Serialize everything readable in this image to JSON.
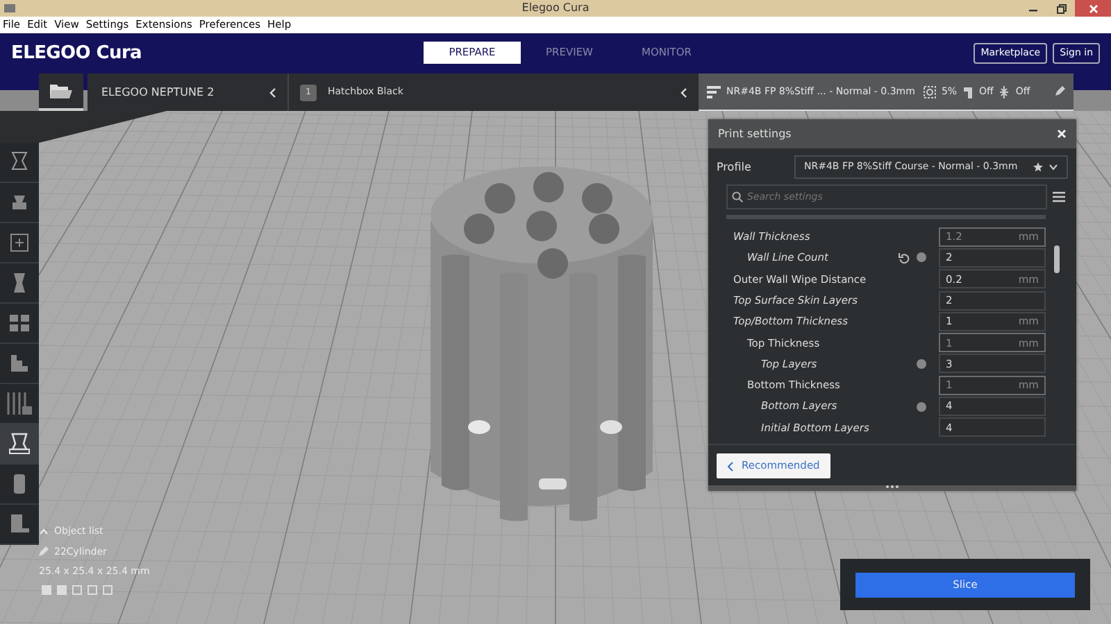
{
  "window": {
    "title": "Elegoo Cura"
  },
  "menu": [
    "File",
    "Edit",
    "View",
    "Settings",
    "Extensions",
    "Preferences",
    "Help"
  ],
  "header": {
    "logo": "ELEGOO Cura",
    "stages": [
      {
        "label": "PREPARE",
        "selected": true
      },
      {
        "label": "PREVIEW",
        "selected": false
      },
      {
        "label": "MONITOR",
        "selected": false
      }
    ],
    "buttons": [
      "Marketplace",
      "Sign in"
    ]
  },
  "toolbar": {
    "printer": "ELEGOO NEPTUNE 2",
    "extruder": "1",
    "material": "Hatchbox Black",
    "profile": "NR#4B FP 8%Stiff ... - Normal - 0.3mm",
    "infill": "5%",
    "support": "Off",
    "adhesion": "Off"
  },
  "tools": [
    {
      "selected": false
    },
    {
      "selected": false
    },
    {
      "selected": false
    },
    {
      "selected": false
    },
    {
      "selected": false
    },
    {
      "selected": false
    },
    {
      "selected": false
    },
    {
      "selected": true
    },
    {
      "selected": false
    },
    {
      "selected": false
    }
  ],
  "object_list": {
    "toggle": "Object list",
    "object": "22Cylinder",
    "dimensions": "25.4 x 25.4 x 25.4 mm"
  },
  "print_settings": {
    "title": "Print settings",
    "profile_label": "Profile",
    "profile": "NR#4B FP 8%Stiff Course - Normal - 0.3mm",
    "search": {
      "placeholder": "Search settings"
    },
    "settings": [
      {
        "label": "Wall Thickness",
        "changed": true,
        "reset": false,
        "info": false,
        "value": "1.2",
        "unit": "mm",
        "computed": true,
        "children": [
          {
            "label": "Wall Line Count",
            "changed": true,
            "reset": true,
            "info": true,
            "value": "2",
            "computed": false
          }
        ]
      },
      {
        "label": "Outer Wall Wipe Distance",
        "changed": false,
        "reset": false,
        "info": false,
        "value": "0.2",
        "unit": "mm",
        "computed": false
      },
      {
        "label": "Top Surface Skin Layers",
        "changed": true,
        "reset": false,
        "info": false,
        "value": "2",
        "computed": false
      },
      {
        "label": "Top/Bottom Thickness",
        "changed": true,
        "reset": false,
        "info": false,
        "value": "1",
        "unit": "mm",
        "computed": false,
        "children": [
          {
            "label": "Top Thickness",
            "changed": false,
            "reset": false,
            "info": false,
            "value": "1",
            "unit": "mm",
            "computed": true,
            "children": [
              {
                "label": "Top Layers",
                "changed": true,
                "reset": false,
                "info": true,
                "value": "3",
                "computed": false
              }
            ]
          },
          {
            "label": "Bottom Thickness",
            "changed": false,
            "reset": false,
            "info": false,
            "value": "1",
            "unit": "mm",
            "computed": true,
            "children": [
              {
                "label": "Bottom Layers",
                "changed": true,
                "reset": false,
                "info": true,
                "value": "4",
                "computed": false
              },
              {
                "label": "Initial Bottom Layers",
                "changed": true,
                "reset": false,
                "info": false,
                "value": "4",
                "computed": false
              }
            ]
          }
        ]
      }
    ],
    "mode_button": "Recommended"
  },
  "slice_button": "Slice"
}
